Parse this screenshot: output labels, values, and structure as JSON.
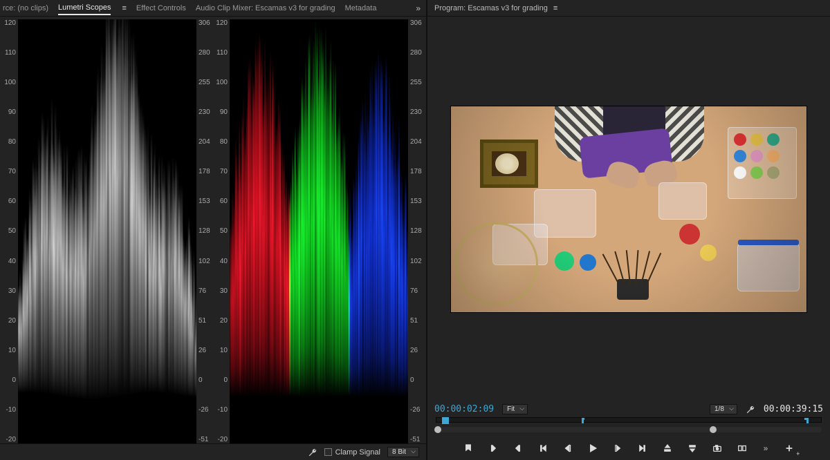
{
  "tabs": {
    "source": "rce: (no clips)",
    "lumetri": "Lumetri Scopes",
    "effect": "Effect Controls",
    "mixer": "Audio Clip Mixer: Escamas v3 for grading",
    "metadata": "Metadata"
  },
  "program": {
    "label": "Program: Escamas v3 for grading"
  },
  "scopes": {
    "luma": {
      "left_scale": [
        "120",
        "110",
        "100",
        "90",
        "80",
        "70",
        "60",
        "50",
        "40",
        "30",
        "20",
        "10",
        "0",
        "-10",
        "-20"
      ],
      "right_scale": [
        "306",
        "280",
        "255",
        "230",
        "204",
        "178",
        "153",
        "128",
        "102",
        "76",
        "51",
        "26",
        "0",
        "-26",
        "-51"
      ]
    },
    "rgb": {
      "left_scale": [
        "120",
        "110",
        "100",
        "90",
        "80",
        "70",
        "60",
        "50",
        "40",
        "30",
        "20",
        "10",
        "0",
        "-10",
        "-20"
      ],
      "right_scale": [
        "306",
        "280",
        "255",
        "230",
        "204",
        "178",
        "153",
        "128",
        "102",
        "76",
        "51",
        "26",
        "0",
        "-26",
        "-51"
      ]
    }
  },
  "footer": {
    "clamp_label": "Clamp Signal",
    "bitdepth": "8 Bit"
  },
  "monitor": {
    "tc_current": "00:00:02:09",
    "zoom": "Fit",
    "res": "1/8",
    "tc_total": "00:00:39:15"
  }
}
